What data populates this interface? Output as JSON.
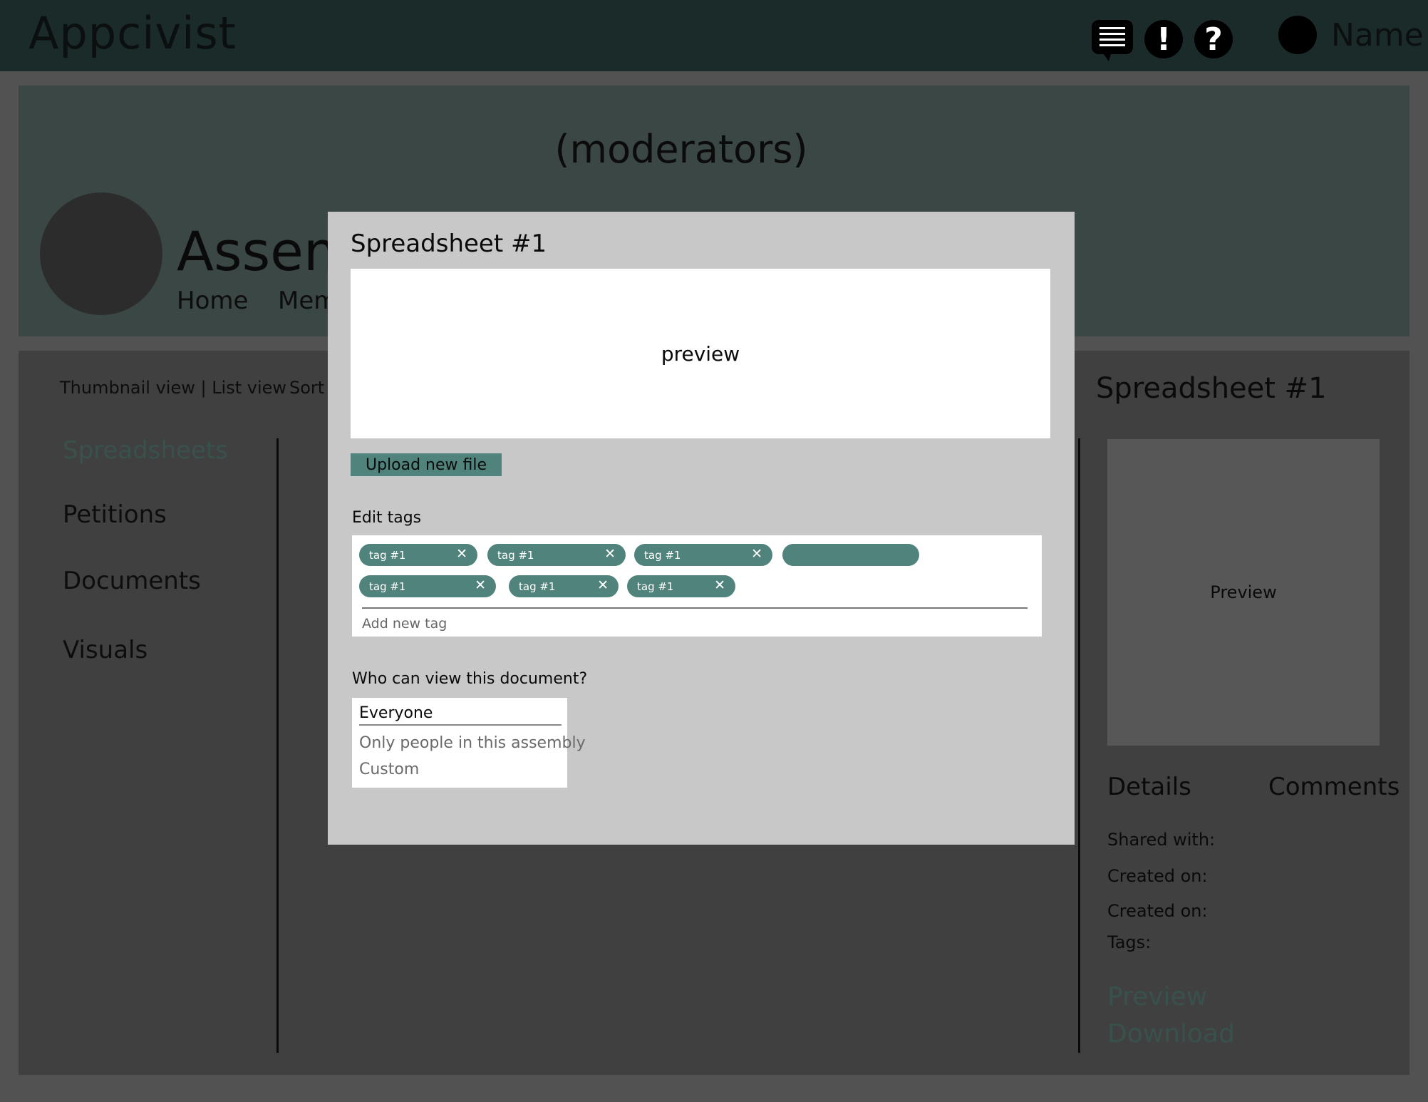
{
  "app": {
    "title": "Appcivist",
    "user_name": "Name",
    "icons": {
      "chat": "chat-icon",
      "alert": "!",
      "help": "?"
    }
  },
  "assembly": {
    "banner_text": "(moderators)",
    "name": "Assem",
    "nav": [
      "Home",
      "Mem"
    ]
  },
  "toolbar": {
    "view_toggle": "Thumbnail view | List view",
    "sort_label": "Sort b"
  },
  "sidebar": {
    "items": [
      {
        "label": "Spreadsheets",
        "active": true
      },
      {
        "label": "Petitions",
        "active": false
      },
      {
        "label": "Documents",
        "active": false
      },
      {
        "label": "Visuals",
        "active": false
      }
    ]
  },
  "detail": {
    "title": "Spreadsheet #1",
    "preview_label": "Preview",
    "tabs": [
      "Details",
      "Comments"
    ],
    "meta": [
      "Shared with:",
      "Created on:",
      "Created on:",
      "Tags:"
    ],
    "links": [
      "Preview",
      "Download"
    ]
  },
  "modal": {
    "title": "Spreadsheet #1",
    "preview_label": "preview",
    "upload_label": "Upload new file",
    "edit_tags_label": "Edit tags",
    "tags": [
      "tag #1",
      "tag #1",
      "tag #1",
      "",
      "tag #1",
      "tag #1",
      "tag #1"
    ],
    "tag_close": "✕",
    "add_tag_placeholder": "Add new tag",
    "visibility_label": "Who can view this document?",
    "visibility_options": [
      "Everyone",
      "Only people in this assembly",
      "Custom"
    ],
    "visibility_selected": "Everyone"
  },
  "colors": {
    "topbar": "#1a2b29",
    "accent": "#4f837b",
    "active_link": "#39514c",
    "modal_bg": "#c8c8c8"
  }
}
